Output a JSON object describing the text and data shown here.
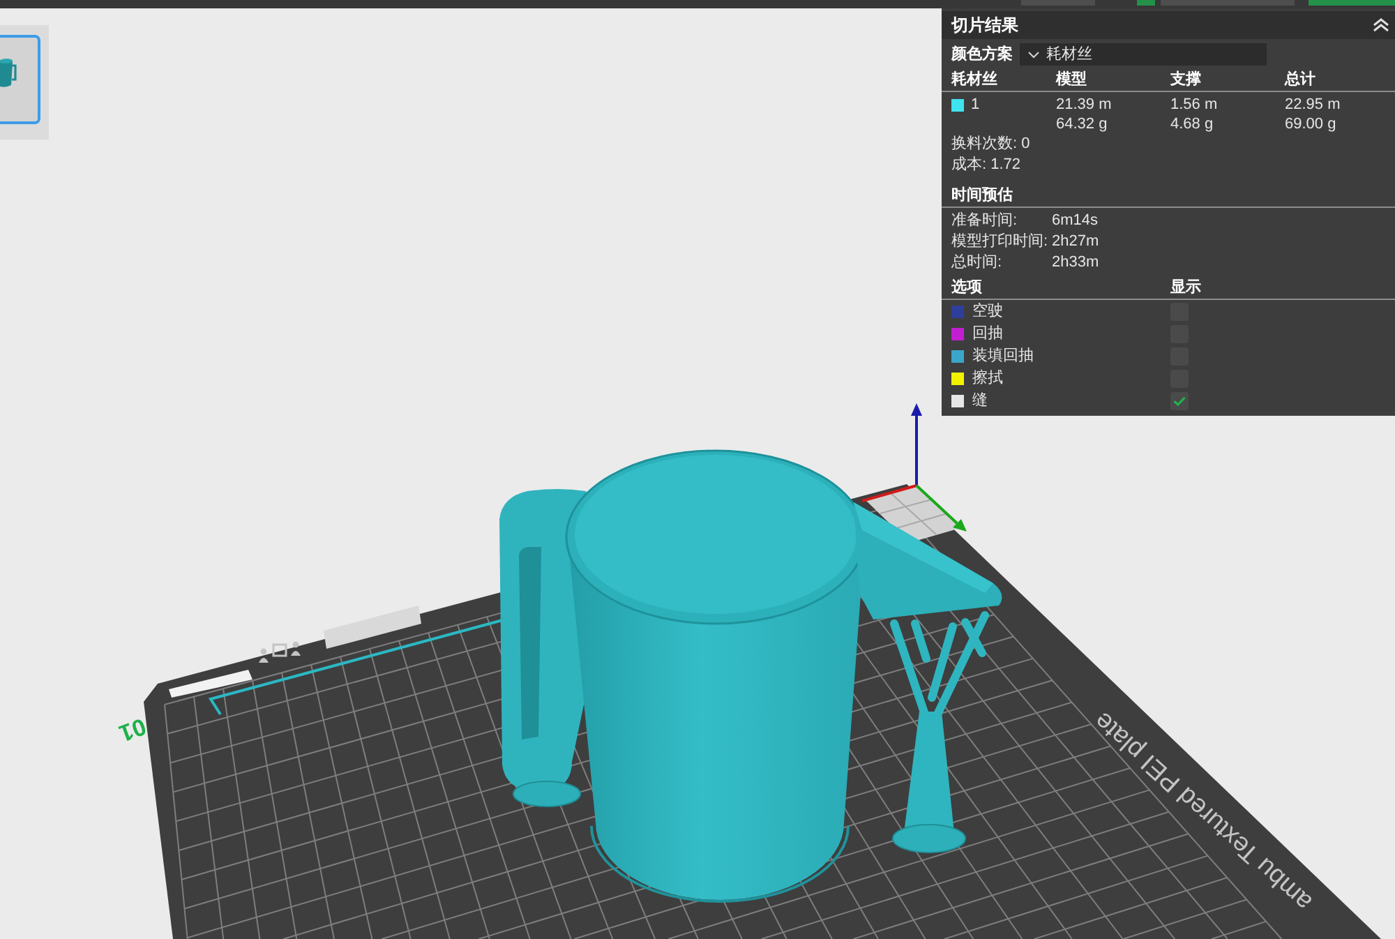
{
  "top_bar": {
    "buttons": [
      {
        "kind": "plain"
      },
      {
        "kind": "accent"
      },
      {
        "kind": "plain"
      },
      {
        "kind": "accent"
      }
    ]
  },
  "plates": [
    {
      "selected": true
    }
  ],
  "viewport": {
    "plate_number": "01",
    "plate_name": "ambu Textured PEI plate"
  },
  "slice_panel": {
    "title": "切片结果",
    "color_scheme": {
      "label": "颜色方案",
      "value": "耗材丝"
    },
    "filament_table": {
      "columns": [
        "耗材丝",
        "模型",
        "支撑",
        "总计"
      ],
      "rows": [
        {
          "color": "#3ee4f0",
          "number": "1",
          "model": [
            "21.39 m",
            "64.32 g"
          ],
          "support": [
            "1.56 m",
            "4.68 g"
          ],
          "total": [
            "22.95 m",
            "69.00 g"
          ]
        }
      ]
    },
    "summary": [
      "换料次数: 0",
      "成本: 1.72"
    ],
    "time_estimate": {
      "title": "时间预估",
      "rows": [
        {
          "label": "准备时间:",
          "value": "6m14s"
        },
        {
          "label": "模型打印时间:",
          "value": "2h27m"
        },
        {
          "label": "总时间:",
          "value": "2h33m"
        }
      ]
    },
    "options": {
      "columns": [
        "选项",
        "显示"
      ],
      "items": [
        {
          "label": "空驶",
          "color": "#2d3e9c",
          "checked": false
        },
        {
          "label": "回抽",
          "color": "#c21fd1",
          "checked": false
        },
        {
          "label": "装填回抽",
          "color": "#3aa6c9",
          "checked": false
        },
        {
          "label": "擦拭",
          "color": "#f2f200",
          "checked": false
        },
        {
          "label": "缝",
          "color": "#e6e6e6",
          "checked": true
        }
      ]
    }
  }
}
